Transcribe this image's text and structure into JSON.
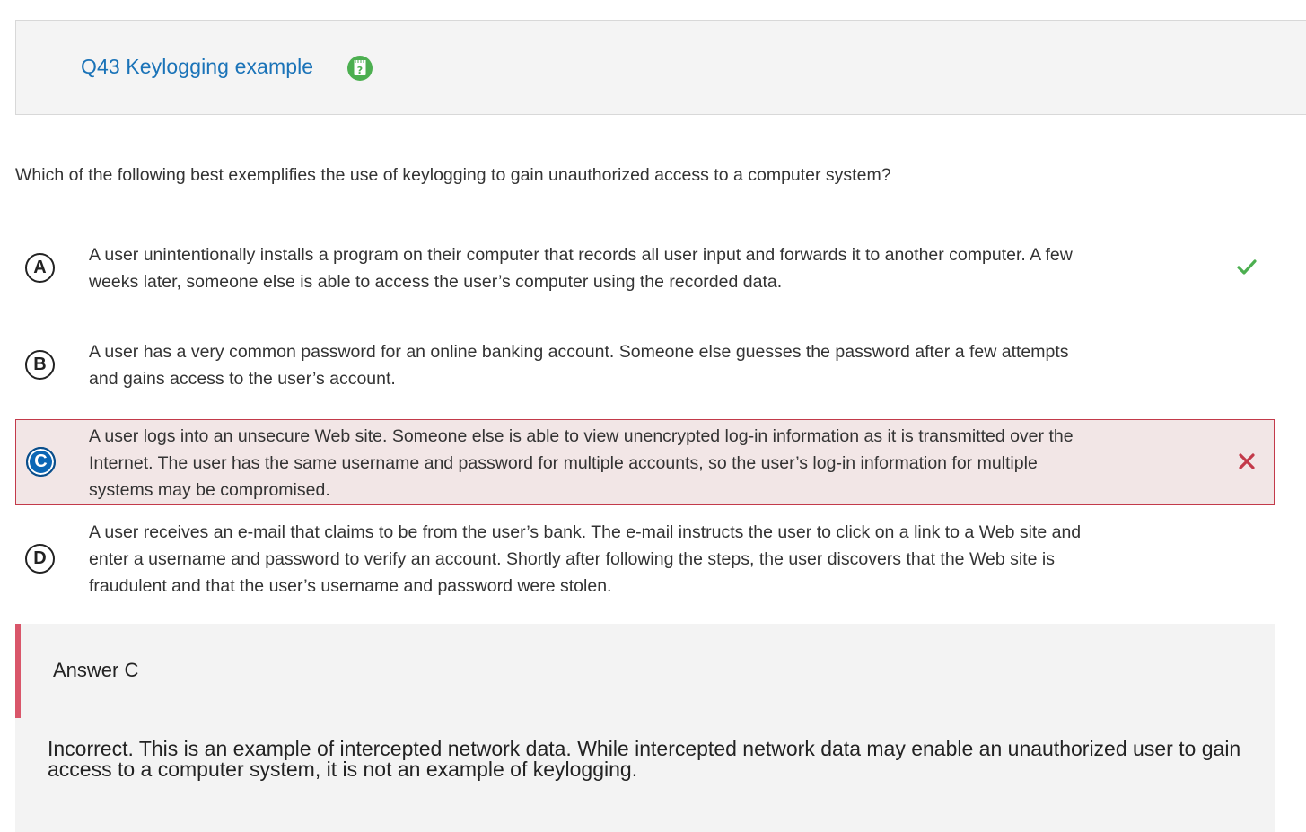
{
  "header": {
    "title": "Q43 Keylogging example",
    "help_icon": "help-note-icon",
    "help_icon_color": "#4caf50"
  },
  "question": {
    "text": "Which of the following best exemplifies the use of keylogging to gain unauthorized access to a computer system?"
  },
  "choices": [
    {
      "letter": "A",
      "text": "A user unintentionally installs a program on their computer that records all user input and forwards it to another computer. A few weeks later, someone else is able to access the user’s computer using the recorded data.",
      "mark": "check-icon",
      "state": "correct"
    },
    {
      "letter": "B",
      "text": "A user has a very common password for an online banking account. Someone else guesses the password after a few attempts and gains access to the user’s account.",
      "mark": "",
      "state": "none"
    },
    {
      "letter": "C",
      "text": "A user logs into an unsecure Web site. Someone else is able to view unencrypted log-in information as it is transmitted over the Internet. The user has the same username and password for multiple accounts, so the user’s log-in information for multiple systems may be compromised.",
      "mark": "x-icon",
      "state": "selected-incorrect"
    },
    {
      "letter": "D",
      "text": "A user receives an e-mail that claims to be from the user’s bank. The e-mail instructs the user to click on a link to a Web site and enter a username and password to verify an account. Shortly after following the steps, the user discovers that the Web site is fraudulent and that the user’s username and password were stolen.",
      "mark": "",
      "state": "none"
    }
  ],
  "explanation": {
    "answer_label": "Answer C",
    "text": "Incorrect. This is an example of intercepted network data. While intercepted network data may enable an unauthorized user to gain access to a computer system, it is not an example of keylogging."
  },
  "colors": {
    "title": "#1a73b8",
    "correct": "#4caf50",
    "incorrect": "#c33a4a",
    "selected": "#0b66b5"
  }
}
